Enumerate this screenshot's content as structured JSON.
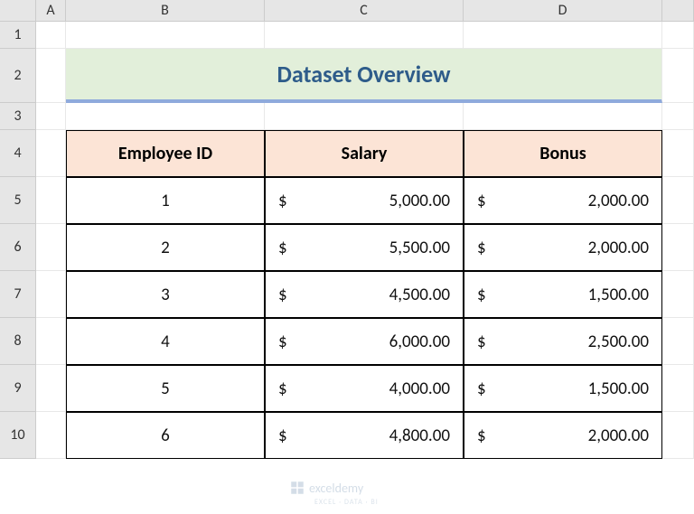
{
  "columns": [
    "",
    "A",
    "B",
    "C",
    "D",
    ""
  ],
  "rows": [
    "1",
    "2",
    "3",
    "4",
    "5",
    "6",
    "7",
    "8",
    "9",
    "10"
  ],
  "title": "Dataset Overview",
  "headers": {
    "col1": "Employee ID",
    "col2": "Salary",
    "col3": "Bonus"
  },
  "data": [
    {
      "id": "1",
      "salary": "5,000.00",
      "bonus": "2,000.00"
    },
    {
      "id": "2",
      "salary": "5,500.00",
      "bonus": "2,000.00"
    },
    {
      "id": "3",
      "salary": "4,500.00",
      "bonus": "1,500.00"
    },
    {
      "id": "4",
      "salary": "6,000.00",
      "bonus": "2,500.00"
    },
    {
      "id": "5",
      "salary": "4,000.00",
      "bonus": "1,500.00"
    },
    {
      "id": "6",
      "salary": "4,800.00",
      "bonus": "2,000.00"
    }
  ],
  "currency": "$",
  "watermark": "exceldemy",
  "watermark_sub": "EXCEL · DATA · BI"
}
